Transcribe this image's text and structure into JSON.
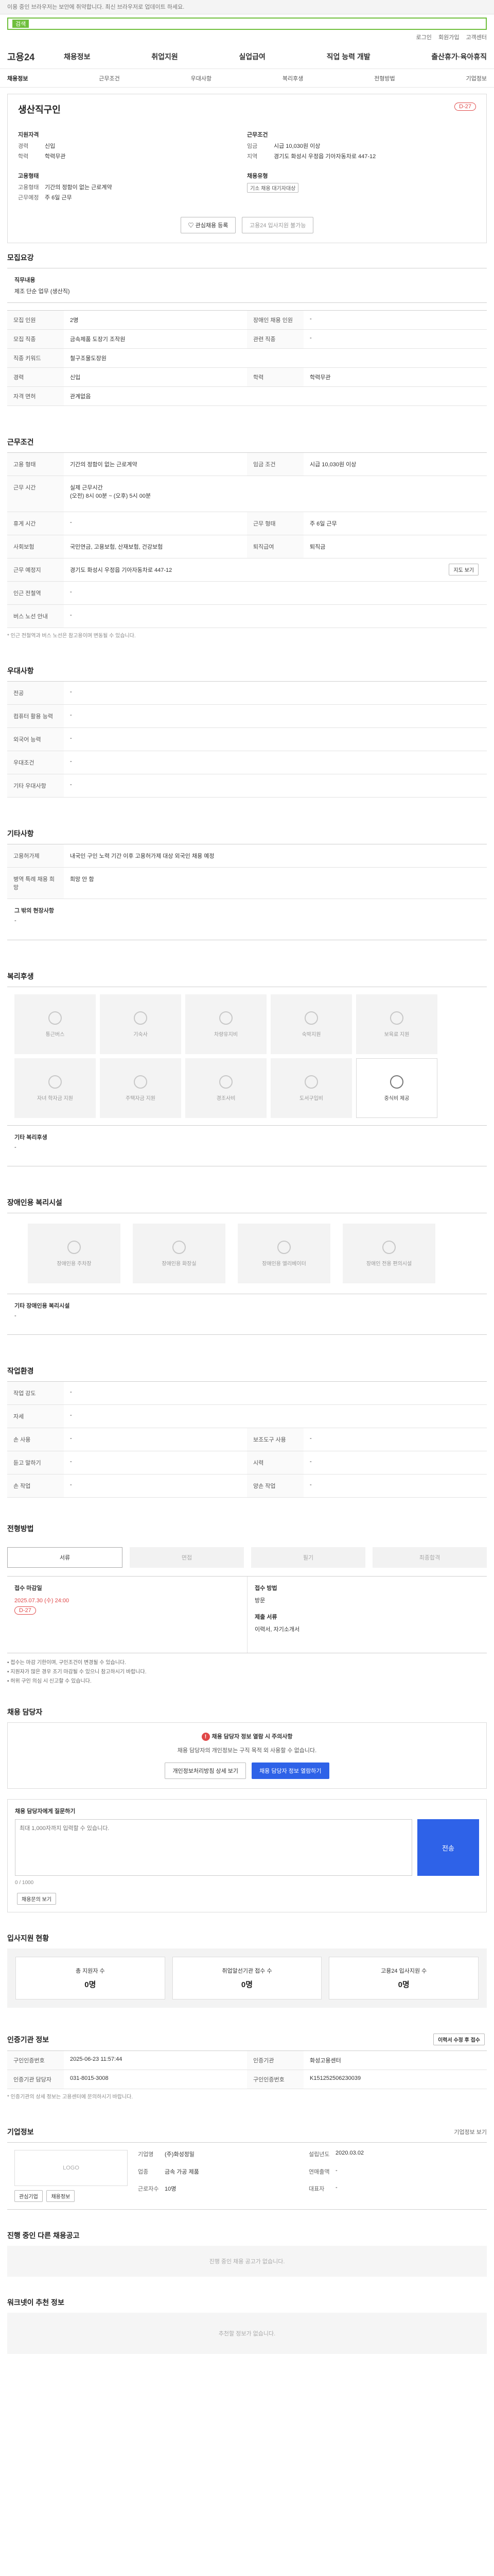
{
  "top_notice": "이용 중인 브라우저는 보안에 취약합니다. 최신 브라우저로 업데이트 하세요.",
  "search": {
    "tag": "검색",
    "placeholder": ""
  },
  "util": [
    "로그인",
    "회원가입",
    "고객센터"
  ],
  "gnb": {
    "logo": "고용24",
    "menu": [
      "채용정보",
      "취업지원",
      "실업급여",
      "직업 능력 개발",
      "출산휴가·육아휴직"
    ]
  },
  "tabs": [
    "채용정보",
    "근무조건",
    "우대사항",
    "복리후생",
    "전형방법",
    "기업정보"
  ],
  "summary": {
    "title": "생산직구인",
    "dday": "D-27",
    "left_title": "지원자격",
    "left": [
      {
        "k": "경력",
        "v": "신입"
      },
      {
        "k": "학력",
        "v": "학력무관"
      }
    ],
    "left2_title": "고용형태",
    "left2": [
      {
        "k": "고용형태",
        "v": "기간의 정함이 없는 근로계약"
      },
      {
        "k": "근무예정",
        "v": "주 6일 근무"
      }
    ],
    "right_title": "근무조건",
    "right": [
      {
        "k": "임금",
        "v": "시급 10,030원 이상"
      },
      {
        "k": "지역",
        "v": "경기도 화성시 우정읍 기아자동차로 447-12"
      }
    ],
    "right2_title": "채용유형",
    "right2_badge": "기소 채용 대기자대상",
    "btn_interest": "관심채용 등록",
    "btn_apply": "고용24 입사지원 불가능"
  },
  "job": {
    "title": "모집요강",
    "desc_title": "직무내용",
    "desc": "제조 단순 업무 (생산직)",
    "rows": [
      [
        "모집 인원",
        "2명",
        "장애인 채용 인원",
        "-"
      ],
      [
        "모집 직종",
        "금속제품 도장기 조작원",
        "관련 직종",
        "-"
      ],
      [
        "직종 키워드",
        "철구조물도장원",
        "",
        ""
      ],
      [
        "경력",
        "신입",
        "학력",
        "학력무관"
      ],
      [
        "자격 면허",
        "관계없음",
        "",
        ""
      ]
    ]
  },
  "work": {
    "title": "근무조건",
    "rows": [
      [
        "고용 형태",
        "기간의 정함이 없는 근로계약",
        "임금 조건",
        "시급 10,030원 이상"
      ],
      [
        "근무 시간",
        "실제 근무시간\n(오전) 8시 00분 ~ (오후) 5시 00분",
        "",
        ""
      ],
      [
        "휴게 시간",
        "-",
        "근무 형태",
        "주 6일 근무"
      ],
      [
        "사회보험",
        "국민연금, 고용보험, 산재보험, 건강보험",
        "퇴직급여",
        "퇴직금"
      ],
      [
        "근무 예정지",
        "경기도 화성시 우정읍 기아자동차로 447-12",
        "",
        ""
      ],
      [
        "인근 전철역",
        "-",
        "",
        ""
      ],
      [
        "버스 노선 안내",
        "-",
        "",
        ""
      ]
    ],
    "map_btn": "지도 보기",
    "note": "* 인근 전철역과 버스 노선은 참고용이며 변동될 수 있습니다."
  },
  "pref": {
    "title": "우대사항",
    "rows": [
      [
        "전공",
        "-"
      ],
      [
        "컴퓨터 활용 능력",
        "-"
      ],
      [
        "외국어 능력",
        "-"
      ],
      [
        "우대조건",
        "-"
      ],
      [
        "기타 우대사항",
        "-"
      ]
    ]
  },
  "etc": {
    "title": "기타사항",
    "rows": [
      [
        "고용허가제",
        "내국인 구인 노력 기간 이후 고용허가제 대상 외국인 채용 예정"
      ],
      [
        "병역 특례 채용 희망",
        "희망 안 함"
      ]
    ],
    "extra_title": "그 밖의 현장사항",
    "extra": "-"
  },
  "welfare": {
    "title": "복리후생",
    "items": [
      {
        "label": "통근버스",
        "on": false
      },
      {
        "label": "기숙사",
        "on": false
      },
      {
        "label": "차량유지비",
        "on": false
      },
      {
        "label": "숙박지원",
        "on": false
      },
      {
        "label": "보육료 지원",
        "on": false
      },
      {
        "label": "자녀 학자금 지원",
        "on": false
      },
      {
        "label": "주택자금 지원",
        "on": false
      },
      {
        "label": "경조사비",
        "on": false
      },
      {
        "label": "도서구입비",
        "on": false
      },
      {
        "label": "중식비 제공",
        "on": true
      }
    ],
    "other_title": "기타 복리후생",
    "other": "-"
  },
  "disability": {
    "title": "장애인용 복리시설",
    "items": [
      "장애인용 주차장",
      "장애인용 화장실",
      "장애인용 엘리베이터",
      "장애인 전용 편의시설"
    ],
    "other_title": "기타 장애인용 복리시설",
    "other": "-"
  },
  "env": {
    "title": "작업환경",
    "rows": [
      [
        "작업 강도",
        "-",
        "",
        ""
      ],
      [
        "자세",
        "-",
        "",
        ""
      ],
      [
        "손 사용",
        "-",
        "보조도구 사용",
        "-"
      ],
      [
        "듣고 말하기",
        "-",
        "시력",
        "-"
      ],
      [
        "손 작업",
        "-",
        "양손 작업",
        "-"
      ]
    ]
  },
  "process": {
    "title": "전형방법",
    "steps": [
      "서류",
      "면접",
      "필기",
      "최종합격"
    ],
    "left_title": "접수 마감일",
    "deadline": "2025.07.30 (수) 24:00",
    "dday": "D-27",
    "right_title": "접수 방법",
    "method": "방문",
    "docs_title": "제출 서류",
    "docs": "이력서, 자기소개서",
    "bullets": [
      "접수는 마감 기한이며, 구인조건이 변경될 수 있습니다.",
      "지원자가 많은 경우 조기 마감될 수 있으니 참고하시기 바랍니다.",
      "허위 구인 의심 시 신고할 수 있습니다."
    ]
  },
  "contact": {
    "title": "채용 담당자",
    "warn": "채용 담당자 정보 열람 시 주의사항",
    "desc": "채용 담당자의 개인정보는 구직 목적 외 사용할 수 없습니다.",
    "btn_view": "개인정보처리방침 상세 보기",
    "btn_contact": "채용 담당자 정보 열람하기",
    "qna_title": "채용 담당자에게 질문하기",
    "qna_placeholder": "최대 1,000자까지 입력할 수 있습니다.",
    "qna_count": "0 / 1000",
    "qna_send": "전송",
    "qna_btn": "채용문의 보기"
  },
  "applicants": {
    "title": "입사지원 현황",
    "items": [
      {
        "label": "총 지원자 수",
        "value": "0명"
      },
      {
        "label": "취업알선기관 접수 수",
        "value": "0명"
      },
      {
        "label": "고용24 입사지원 수",
        "value": "0명"
      }
    ]
  },
  "agency": {
    "title": "인증기관 정보",
    "btn": "이력서 수정 후 접수",
    "rows": [
      [
        "구인인증번호",
        "2025-06-23 11:57:44",
        "인증기관",
        "화성고용센터"
      ],
      [
        "인증기관 담당자",
        "031-8015-3008",
        "구인인증번호",
        "K151252506230039"
      ]
    ],
    "note": "* 인증기관의 상세 정보는 고용센터에 문의하시기 바랍니다."
  },
  "company": {
    "title": "기업정보",
    "btn_more": "기업정보 보기",
    "logo": "LOGO",
    "btn_a": "관심기업",
    "btn_b": "채용정보",
    "info": [
      [
        "기업명",
        "(주)화성정밀"
      ],
      [
        "업종",
        "금속 가공 제품"
      ],
      [
        "근로자수",
        "10명"
      ],
      [
        "설립년도",
        "2020.03.02"
      ],
      [
        "연매출액",
        "-"
      ],
      [
        "대표자",
        "-"
      ]
    ]
  },
  "others": {
    "title": "진행 중인 다른 채용공고",
    "note": "진행 중인 채용 공고가 없습니다."
  },
  "recommend": {
    "title": "워크넷이 추천 정보",
    "note": "추천할 정보가 없습니다."
  }
}
